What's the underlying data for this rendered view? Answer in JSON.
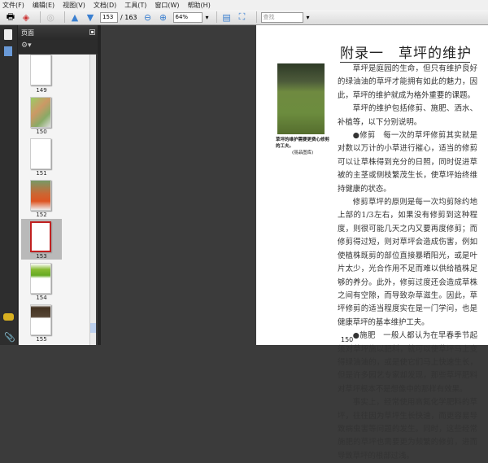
{
  "menu": [
    "文件(F)",
    "编辑(E)",
    "视图(V)",
    "文档(D)",
    "工具(T)",
    "窗口(W)",
    "帮助(H)"
  ],
  "toolbar": {
    "current_page": "153",
    "total_pages": "/ 163",
    "zoom": "64%",
    "search_placeholder": "查找"
  },
  "panel": {
    "title": "页面",
    "thumbnails": [
      {
        "label": "149"
      },
      {
        "label": "150"
      },
      {
        "label": "151"
      },
      {
        "label": "152"
      },
      {
        "label": "153"
      },
      {
        "label": "154"
      },
      {
        "label": "155"
      }
    ],
    "selected": "153"
  },
  "document": {
    "title": "附录一　草坪的维护",
    "caption": "草坪的维护需要更费心修剪的工夫。",
    "caption_credit": "(丽品图库)",
    "paragraphs": [
      "草坪是庭园的生命，但只有维护良好的绿油油的草坪才能拥有如此的魅力，因此，草坪的维护就成为格外重要的课题。",
      "草坪的维护包括修剪、施肥、洒水、补植等，以下分别说明。",
      "●修剪　每一次的草坪修剪其实就是对数以万计的小草进行摧心，适当的修剪可以让草株得到充分的日照，同时促进草被的主茎或侧枝繁茂生长，使草坪始终维持健康的状态。",
      "修剪草坪的原则是每一次均剪除约地上部的1/3左右，如果没有修剪到这种程度，则很可能几天之内又要再度修剪；而修剪得过短，则对草坪会造成伤害，例如使植株既剪的部位直接暴晒阳光，或是叶片太少，光合作用不足而难以供给植株足够的养分。此外，修剪过度还会造成草株之间有空隙，而导致杂草滋生。因此，草坪修剪的适当程度实在是一门学问，也是健康草坪的基本维护工夫。",
      "●施肥　一般人都认为在早春季节起须对草坪施以肥料，就可以使草坪马上变得绿油油的，或是使它们马上快速生长，但是许多园艺专家却发现，那些草坪肥料对草坪根本不是想像中的那样有效果。",
      "事实上，经常使用高氮化学肥料的草坪，往往因为草坪生长快速，而更容易导致病虫害等问题的发生。同时，这些经常施肥的草坪也需要更为频繁的修剪，进而导致草坪的根部过浅。"
    ],
    "page_number": "150"
  }
}
